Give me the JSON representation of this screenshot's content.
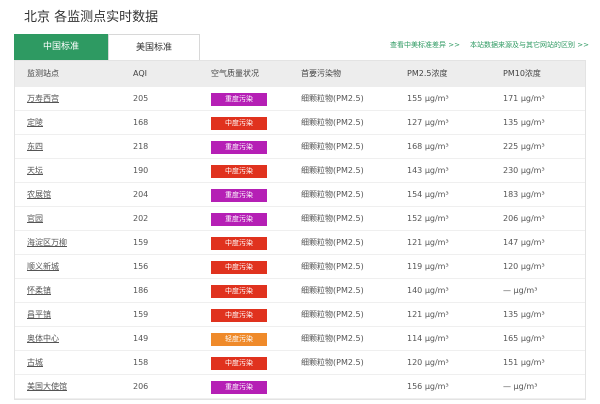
{
  "title": "北京 各监测点实时数据",
  "tabs": [
    {
      "label": "中国标准",
      "active": true
    },
    {
      "label": "美国标准",
      "active": false
    }
  ],
  "links": {
    "view_standard": "查看中美标准差异 >>",
    "data_source": "本站数据来源及与其它网站的区别 >>"
  },
  "table": {
    "columns": [
      "监测站点",
      "AQI",
      "空气质量状况",
      "首要污染物",
      "PM2.5浓度",
      "PM10浓度"
    ],
    "rows": [
      {
        "station": "万寿西宫",
        "aqi": "205",
        "quality": "重度污染",
        "quality_color": "#b51fb5",
        "pollutant": "细颗粒物(PM2.5)",
        "pm25": "155 μg/m³",
        "pm10": "171 μg/m³"
      },
      {
        "station": "定陵",
        "aqi": "168",
        "quality": "中度污染",
        "quality_color": "#e0321e",
        "pollutant": "细颗粒物(PM2.5)",
        "pm25": "127 μg/m³",
        "pm10": "135 μg/m³"
      },
      {
        "station": "东四",
        "aqi": "218",
        "quality": "重度污染",
        "quality_color": "#b51fb5",
        "pollutant": "细颗粒物(PM2.5)",
        "pm25": "168 μg/m³",
        "pm10": "225 μg/m³"
      },
      {
        "station": "天坛",
        "aqi": "190",
        "quality": "中度污染",
        "quality_color": "#e0321e",
        "pollutant": "细颗粒物(PM2.5)",
        "pm25": "143 μg/m³",
        "pm10": "230 μg/m³"
      },
      {
        "station": "农展馆",
        "aqi": "204",
        "quality": "重度污染",
        "quality_color": "#b51fb5",
        "pollutant": "细颗粒物(PM2.5)",
        "pm25": "154 μg/m³",
        "pm10": "183 μg/m³"
      },
      {
        "station": "官园",
        "aqi": "202",
        "quality": "重度污染",
        "quality_color": "#b51fb5",
        "pollutant": "细颗粒物(PM2.5)",
        "pm25": "152 μg/m³",
        "pm10": "206 μg/m³"
      },
      {
        "station": "海淀区万柳",
        "aqi": "159",
        "quality": "中度污染",
        "quality_color": "#e0321e",
        "pollutant": "细颗粒物(PM2.5)",
        "pm25": "121 μg/m³",
        "pm10": "147 μg/m³"
      },
      {
        "station": "顺义新城",
        "aqi": "156",
        "quality": "中度污染",
        "quality_color": "#e0321e",
        "pollutant": "细颗粒物(PM2.5)",
        "pm25": "119 μg/m³",
        "pm10": "120 μg/m³"
      },
      {
        "station": "怀柔镇",
        "aqi": "186",
        "quality": "中度污染",
        "quality_color": "#e0321e",
        "pollutant": "细颗粒物(PM2.5)",
        "pm25": "140 μg/m³",
        "pm10": "— μg/m³"
      },
      {
        "station": "昌平镇",
        "aqi": "159",
        "quality": "中度污染",
        "quality_color": "#e0321e",
        "pollutant": "细颗粒物(PM2.5)",
        "pm25": "121 μg/m³",
        "pm10": "135 μg/m³"
      },
      {
        "station": "奥体中心",
        "aqi": "149",
        "quality": "轻度污染",
        "quality_color": "#ef8a2a",
        "pollutant": "细颗粒物(PM2.5)",
        "pm25": "114 μg/m³",
        "pm10": "165 μg/m³"
      },
      {
        "station": "古城",
        "aqi": "158",
        "quality": "中度污染",
        "quality_color": "#e0321e",
        "pollutant": "细颗粒物(PM2.5)",
        "pm25": "120 μg/m³",
        "pm10": "151 μg/m³"
      },
      {
        "station": "美国大使馆",
        "aqi": "206",
        "quality": "重度污染",
        "quality_color": "#b51fb5",
        "pollutant": "",
        "pm25": "156 μg/m³",
        "pm10": "— μg/m³"
      }
    ]
  }
}
